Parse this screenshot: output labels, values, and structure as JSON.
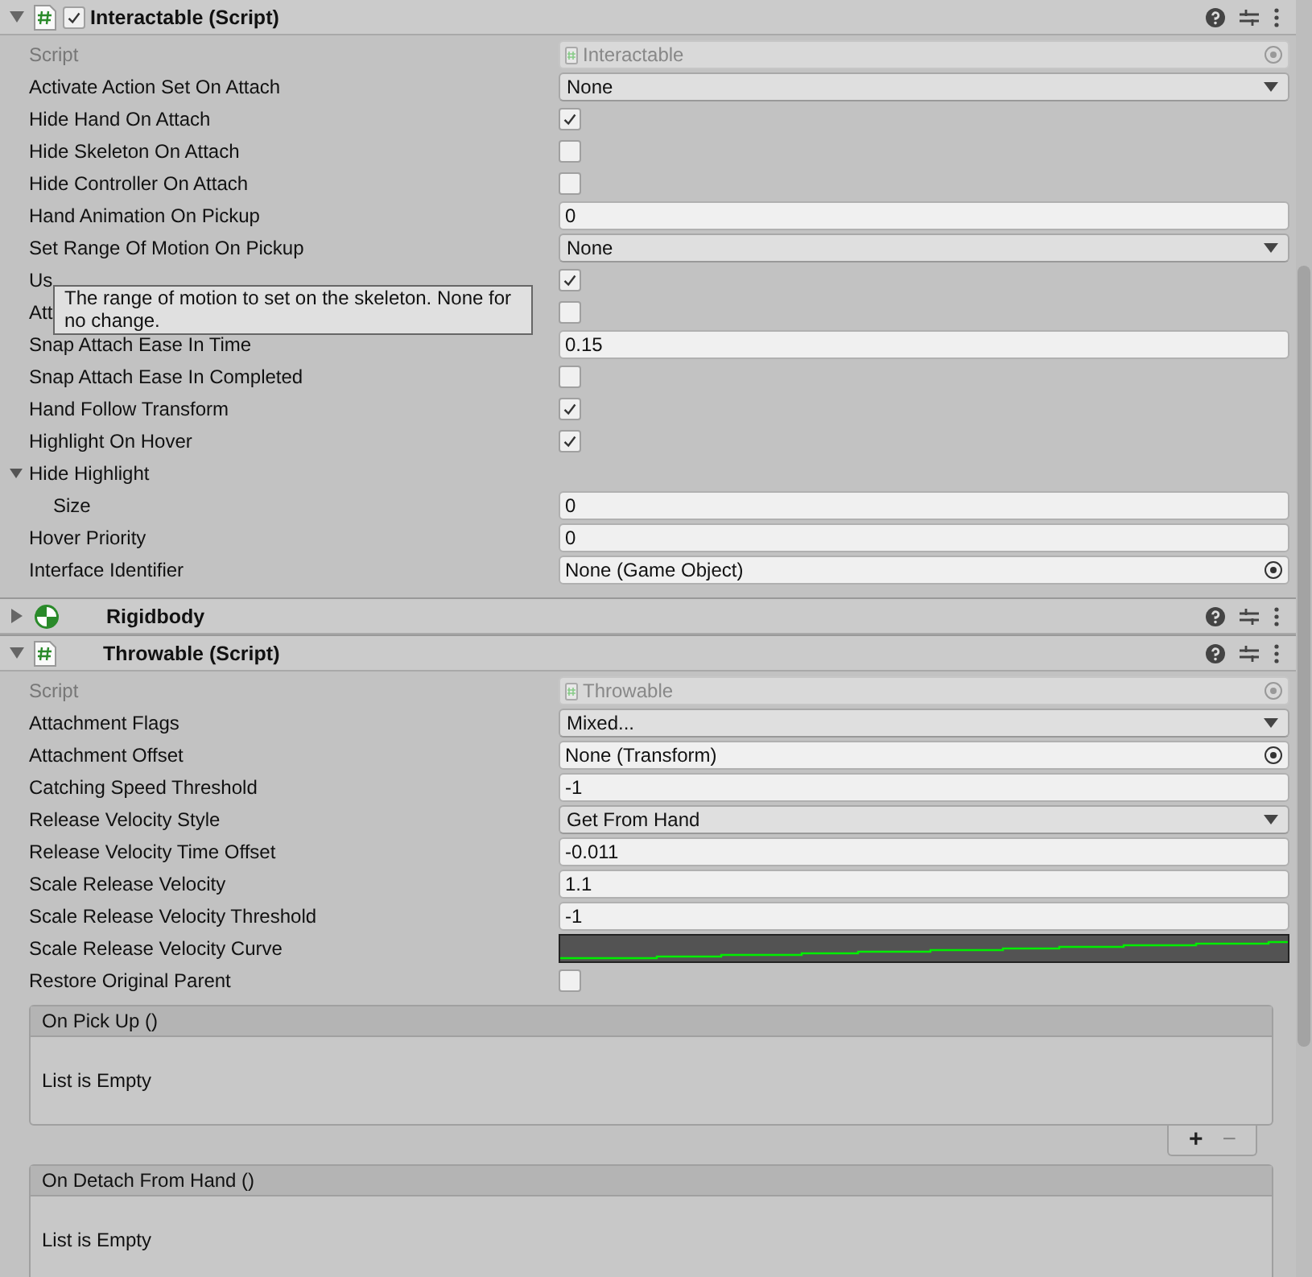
{
  "components": [
    {
      "title": "Interactable (Script)",
      "kind": "script",
      "expanded": true,
      "enabled": true,
      "fields": [
        {
          "kind": "script",
          "label": "Script",
          "value": "Interactable",
          "disabled": true
        },
        {
          "kind": "dropdown",
          "label": "Activate Action Set On Attach",
          "value": "None"
        },
        {
          "kind": "checkbox",
          "label": "Hide Hand On Attach",
          "checked": true
        },
        {
          "kind": "checkbox",
          "label": "Hide Skeleton On Attach",
          "checked": false
        },
        {
          "kind": "checkbox",
          "label": "Hide Controller On Attach",
          "checked": false
        },
        {
          "kind": "text",
          "label": "Hand Animation On Pickup",
          "value": "0"
        },
        {
          "kind": "dropdown",
          "label": "Set Range Of Motion On Pickup",
          "value": "None"
        },
        {
          "kind": "checkbox",
          "label": "Us",
          "checked": true
        },
        {
          "kind": "checkbox",
          "label": "Att",
          "checked": false
        },
        {
          "kind": "text",
          "label": "Snap Attach Ease In Time",
          "value": "0.15"
        },
        {
          "kind": "checkbox",
          "label": "Snap Attach Ease In Completed",
          "checked": false
        },
        {
          "kind": "checkbox",
          "label": "Hand Follow Transform",
          "checked": true
        },
        {
          "kind": "checkbox",
          "label": "Highlight On Hover",
          "checked": true
        },
        {
          "kind": "foldout",
          "label": "Hide Highlight",
          "expanded": true,
          "children": [
            {
              "kind": "text",
              "label": "Size",
              "value": "0"
            }
          ]
        },
        {
          "kind": "text",
          "label": "Hover Priority",
          "value": "0"
        },
        {
          "kind": "object",
          "label": "Interface Identifier",
          "value": "None (Game Object)",
          "disabled": false
        }
      ],
      "tooltip": "The range of motion to set on the skeleton. None for no change."
    },
    {
      "title": "Rigidbody",
      "kind": "rigidbody",
      "expanded": false
    },
    {
      "title": "Throwable (Script)",
      "kind": "script",
      "expanded": true,
      "fields": [
        {
          "kind": "script",
          "label": "Script",
          "value": "Throwable",
          "disabled": true
        },
        {
          "kind": "dropdown",
          "label": "Attachment Flags",
          "value": "Mixed..."
        },
        {
          "kind": "object",
          "label": "Attachment Offset",
          "value": "None (Transform)",
          "disabled": false
        },
        {
          "kind": "text",
          "label": "Catching Speed Threshold",
          "value": "-1"
        },
        {
          "kind": "dropdown",
          "label": "Release Velocity Style",
          "value": "Get From Hand"
        },
        {
          "kind": "text",
          "label": "Release Velocity Time Offset",
          "value": "-0.011"
        },
        {
          "kind": "text",
          "label": "Scale Release Velocity",
          "value": "1.1"
        },
        {
          "kind": "text",
          "label": "Scale Release Velocity Threshold",
          "value": "-1"
        },
        {
          "kind": "curve",
          "label": "Scale Release Velocity Curve"
        },
        {
          "kind": "checkbox",
          "label": "Restore Original Parent",
          "checked": false
        }
      ],
      "events": [
        {
          "title": "On Pick Up ()",
          "empty_text": "List is Empty",
          "add": "+",
          "remove": "−"
        },
        {
          "title": "On Detach From Hand ()",
          "empty_text": "List is Empty"
        }
      ]
    }
  ]
}
